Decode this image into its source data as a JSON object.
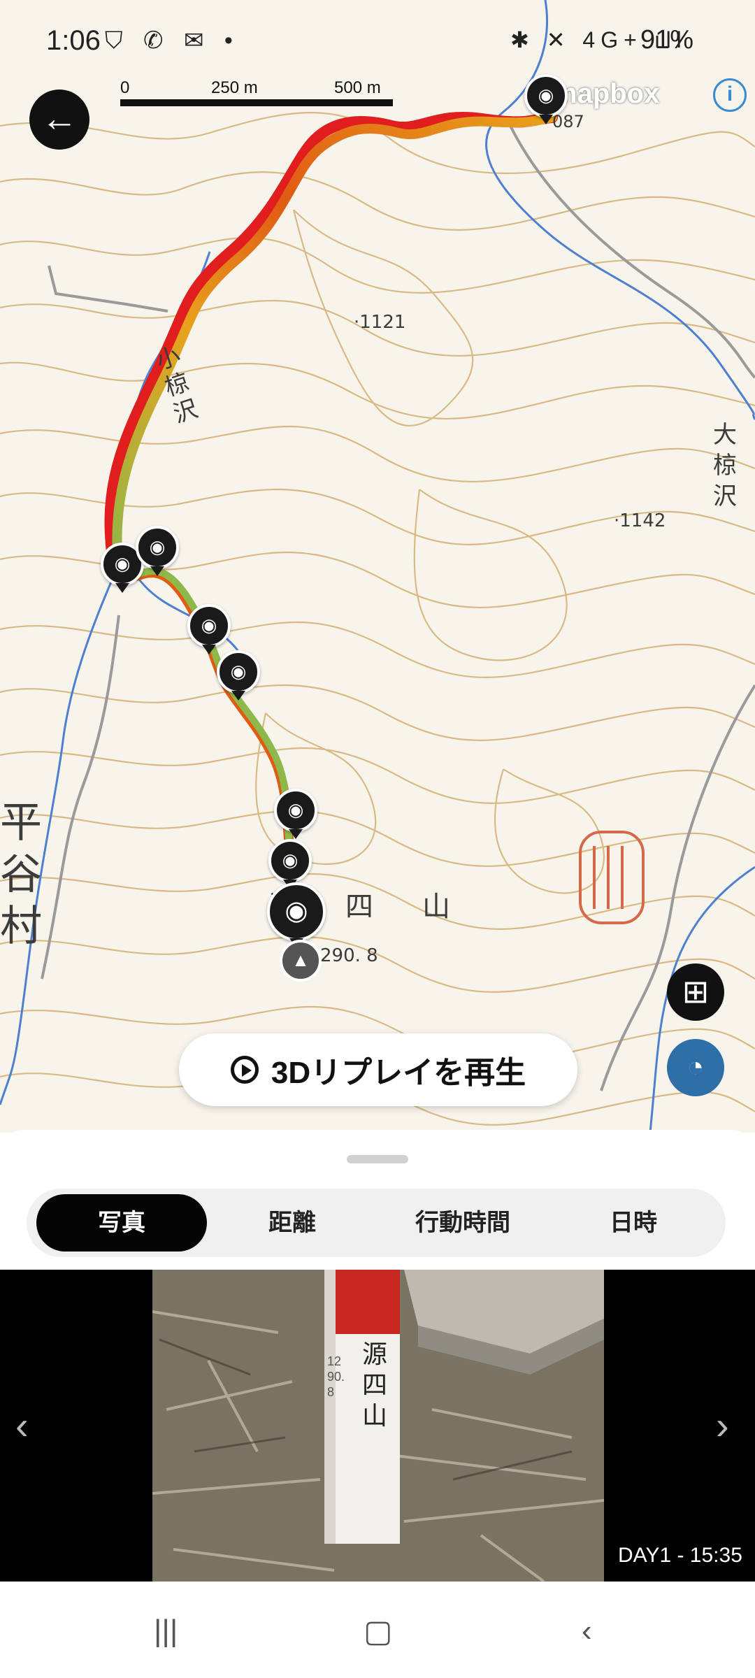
{
  "status_bar": {
    "time": "1:06",
    "left_icons": "⛉ ✆ ✉ •",
    "right_icons": "✱ ✕ 4G+ ıll",
    "battery": "91%"
  },
  "map": {
    "scale": {
      "t0": "0",
      "t1": "250 m",
      "t2": "500 m"
    },
    "attribution": "mapbox",
    "labels": {
      "peak_1121": "·1121",
      "peak_1142": "·1142",
      "point_087": "087",
      "stream_1": "小椋沢",
      "stream_2": "大椋沢",
      "village": "平谷村",
      "summit_name": "源四山",
      "summit_elevation": "290. 8"
    },
    "icons": {
      "back": "arrow-left-icon",
      "camera": "camera-icon",
      "summit": "mountain-icon",
      "add_note": "add-note-icon",
      "speed": "speedometer-icon",
      "info": "info-icon"
    }
  },
  "replay_button": {
    "label": "3Dリプレイを再生"
  },
  "tabs": [
    {
      "label": "写真",
      "active": true
    },
    {
      "label": "距離",
      "active": false
    },
    {
      "label": "行動時間",
      "active": false
    },
    {
      "label": "日時",
      "active": false
    }
  ],
  "photo_viewer": {
    "timestamp": "DAY1 - 15:35",
    "post_text": "源四山",
    "post_elevation": "1290.8"
  },
  "colors": {
    "route_start": "#e8a21c",
    "route_mid": "#e05b14",
    "route_end": "#8fb84a",
    "route_alt": "#e01e1e",
    "accent_blue": "#2f6fa8"
  }
}
